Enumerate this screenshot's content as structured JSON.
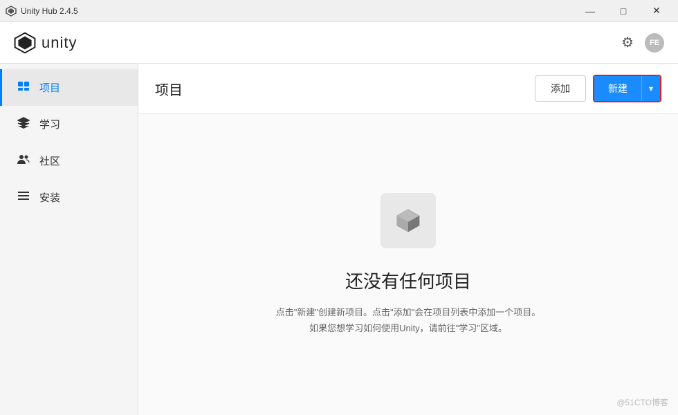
{
  "titlebar": {
    "icon": "⬡",
    "title": "Unity Hub 2.4.5",
    "controls": {
      "minimize": "—",
      "maximize": "□",
      "close": "✕"
    }
  },
  "header": {
    "logo_text": "unity",
    "gear_label": "⚙",
    "user_label": "FE"
  },
  "sidebar": {
    "items": [
      {
        "id": "projects",
        "icon": "◈",
        "label": "项目",
        "active": true
      },
      {
        "id": "learn",
        "icon": "🎓",
        "label": "学习",
        "active": false
      },
      {
        "id": "community",
        "icon": "👥",
        "label": "社区",
        "active": false
      },
      {
        "id": "installs",
        "icon": "☰",
        "label": "安装",
        "active": false
      }
    ]
  },
  "content": {
    "title": "项目",
    "add_button": "添加",
    "new_button": "新建",
    "dropdown_arrow": "▾"
  },
  "empty_state": {
    "title": "还没有任何项目",
    "desc_line1": "点击\"新建\"创建新项目。点击\"添加\"会在项目列表中添加一个项目。",
    "desc_line2": "如果您想学习如何使用Unity，请前往\"学习\"区域。"
  },
  "watermark": "@51CTO博客"
}
